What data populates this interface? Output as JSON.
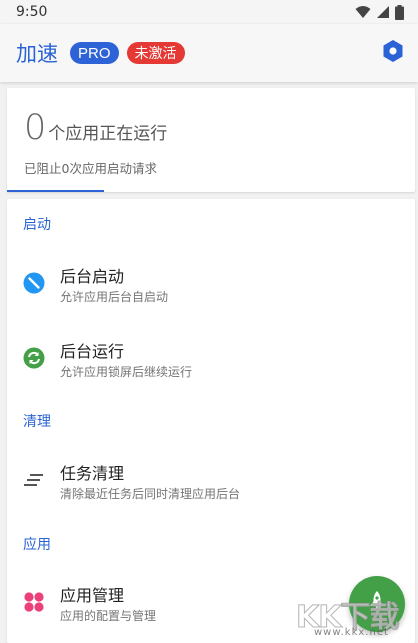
{
  "status_bar": {
    "time": "9:50"
  },
  "app_bar": {
    "title": "加速",
    "badge_pro": "PRO",
    "badge_status": "未激活"
  },
  "summary": {
    "count": "0",
    "running_text": "个应用正在运行",
    "blocked_text": "已阻止0次应用启动请求"
  },
  "sections": [
    {
      "header": "启动"
    },
    {
      "header": "清理"
    },
    {
      "header": "应用"
    }
  ],
  "items": [
    {
      "title": "后台启动",
      "subtitle": "允许应用后台自启动"
    },
    {
      "title": "后台运行",
      "subtitle": "允许应用锁屏后继续运行"
    },
    {
      "title": "任务清理",
      "subtitle": "清除最近任务后同时清理应用后台"
    },
    {
      "title": "应用管理",
      "subtitle": "应用的配置与管理"
    }
  ],
  "watermark": {
    "brand": "KK下载",
    "url": "www.kkx.net"
  },
  "colors": {
    "accent": "#2a63d6",
    "badge_inactive": "#e53935",
    "fab": "#43a047",
    "launch_icon": "#2196f3",
    "run_icon": "#43a047",
    "app_manage_icon": "#ec407a"
  },
  "icons": {
    "status": [
      "wifi-icon",
      "cellular-signal-icon",
      "battery-icon"
    ],
    "app_bar_action": "hexagon-settings-icon",
    "items": [
      "no-autostart-icon",
      "sync-icon",
      "clear-tasks-icon",
      "apps-grid-icon"
    ],
    "fab": "rocket-icon"
  }
}
